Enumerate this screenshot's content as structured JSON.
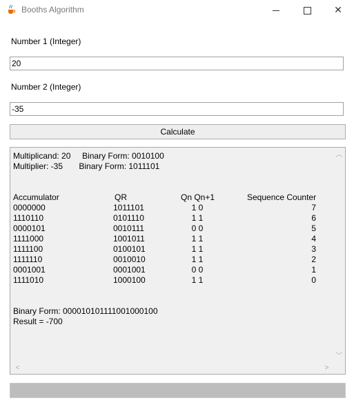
{
  "window": {
    "title": "Booths Algorithm"
  },
  "form": {
    "number1_label": "Number 1 (Integer)",
    "number1_value": "20",
    "number2_label": "Number 2 (Integer)",
    "number2_value": "-35",
    "calculate_label": "Calculate"
  },
  "output": {
    "multiplicand_line": "Multiplicand: 20     Binary Form: 0010100",
    "multiplier_line": "Multiplier: -35       Binary Form: 1011101",
    "headers": {
      "acc": "Accumulator",
      "qr": "QR",
      "qn": "Qn Qn+1",
      "sc": "Sequence Counter"
    },
    "rows": [
      {
        "acc": "0000000",
        "qr": "1011101",
        "qn": "1 0",
        "sc": "7"
      },
      {
        "acc": "1110110",
        "qr": "0101110",
        "qn": "1 1",
        "sc": "6"
      },
      {
        "acc": "0000101",
        "qr": "0010111",
        "qn": "0 0",
        "sc": "5"
      },
      {
        "acc": "1111000",
        "qr": "1001011",
        "qn": "1 1",
        "sc": "4"
      },
      {
        "acc": "1111100",
        "qr": "0100101",
        "qn": "1 1",
        "sc": "3"
      },
      {
        "acc": "1111110",
        "qr": "0010010",
        "qn": "1 1",
        "sc": "2"
      },
      {
        "acc": "0001001",
        "qr": "0001001",
        "qn": "0 0",
        "sc": "1"
      },
      {
        "acc": "1111010",
        "qr": "1000100",
        "qn": "1 1",
        "sc": "0"
      }
    ],
    "binary_result_line": "Binary Form: 000010101111001000100",
    "result_line": "Result = -700"
  },
  "icons": {
    "app": "java-cup-icon",
    "minimize": "minimize-icon",
    "maximize": "maximize-icon",
    "close": "close-icon"
  },
  "colors": {
    "progress_fill": "#bdbdbd",
    "output_bg": "#f0f0f0"
  }
}
